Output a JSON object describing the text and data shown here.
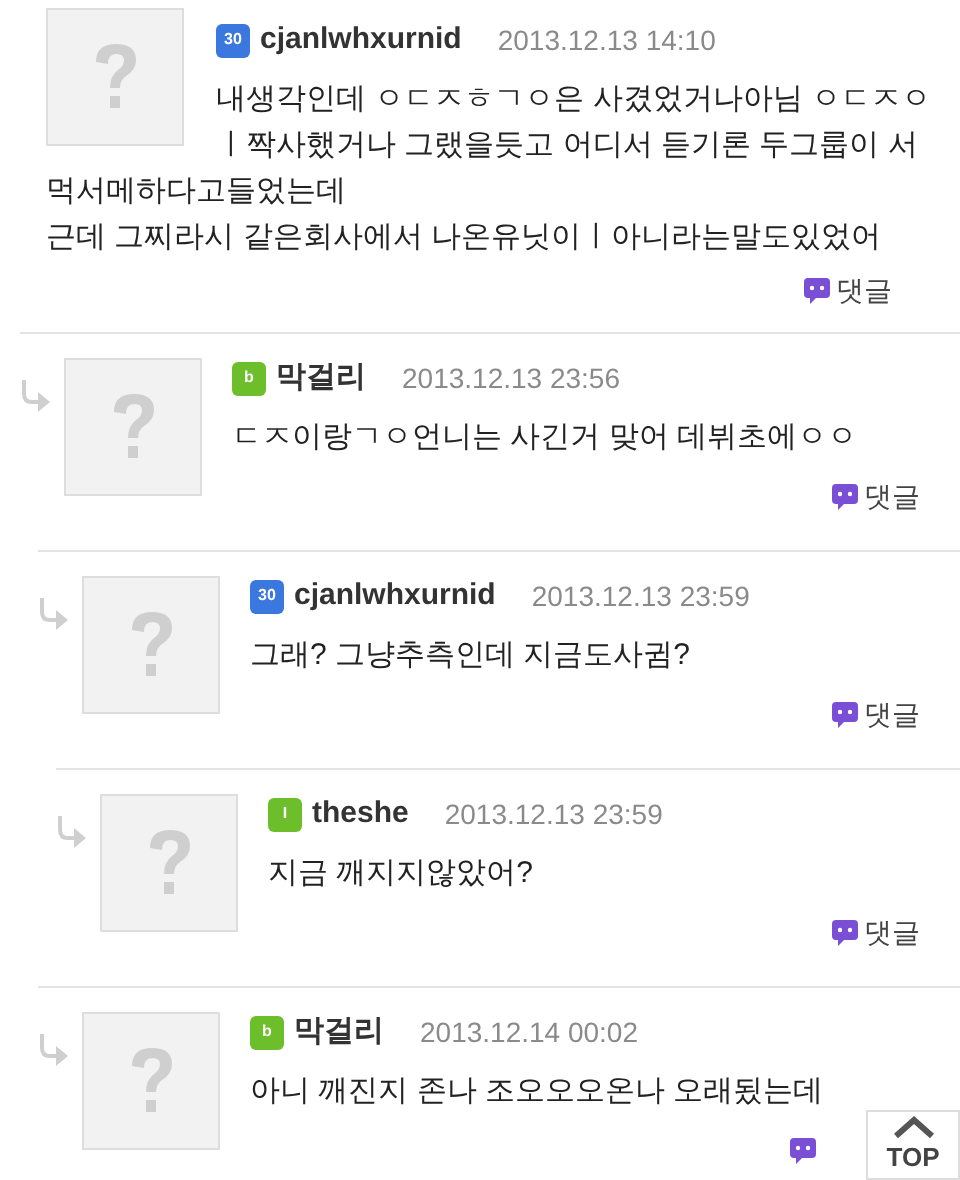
{
  "comments": [
    {
      "username": "cjanlwhxurnid",
      "badge": {
        "text": "30",
        "color": "#3a78e0"
      },
      "time": "2013.12.13 14:10",
      "text_lines": [
        "내생각인데 ㅇㄷㅈㅎㄱㅇ은 사겼었거나아님 ㅇㄷㅈㅇ",
        "ㅣ짝사했거나 그랬을듯고 어디서 듣기론 두그룹이 서",
        "먹서메하다고들었는데",
        "근데 그찌라시 같은회사에서 나온유닛이ㅣ아니라는말도있었어"
      ],
      "reply": "댓글",
      "children": [
        {
          "username": "막걸리",
          "badge": {
            "text": "b",
            "color": "#6cbf2a"
          },
          "time": "2013.12.13 23:56",
          "text": "ㄷㅈ이랑ㄱㅇ언니는 사긴거 맞어 데뷔초에ㅇㅇ",
          "reply": "댓글",
          "children": [
            {
              "username": "cjanlwhxurnid",
              "badge": {
                "text": "30",
                "color": "#3a78e0"
              },
              "time": "2013.12.13 23:59",
              "text": "그래? 그냥추측인데 지금도사귐?",
              "reply": "댓글",
              "children": [
                {
                  "username": "theshe",
                  "badge": {
                    "text": "I",
                    "color": "#6cbf2a"
                  },
                  "time": "2013.12.13 23:59",
                  "text": "지금 깨지지않았어?",
                  "reply": "댓글"
                }
              ]
            },
            {
              "username": "막걸리",
              "badge": {
                "text": "b",
                "color": "#6cbf2a"
              },
              "time": "2013.12.14 00:02",
              "text": "아니 깨진지 존나 조오오오온나 오래됬는데"
            }
          ]
        }
      ]
    }
  ],
  "top_button": {
    "label": "TOP"
  }
}
